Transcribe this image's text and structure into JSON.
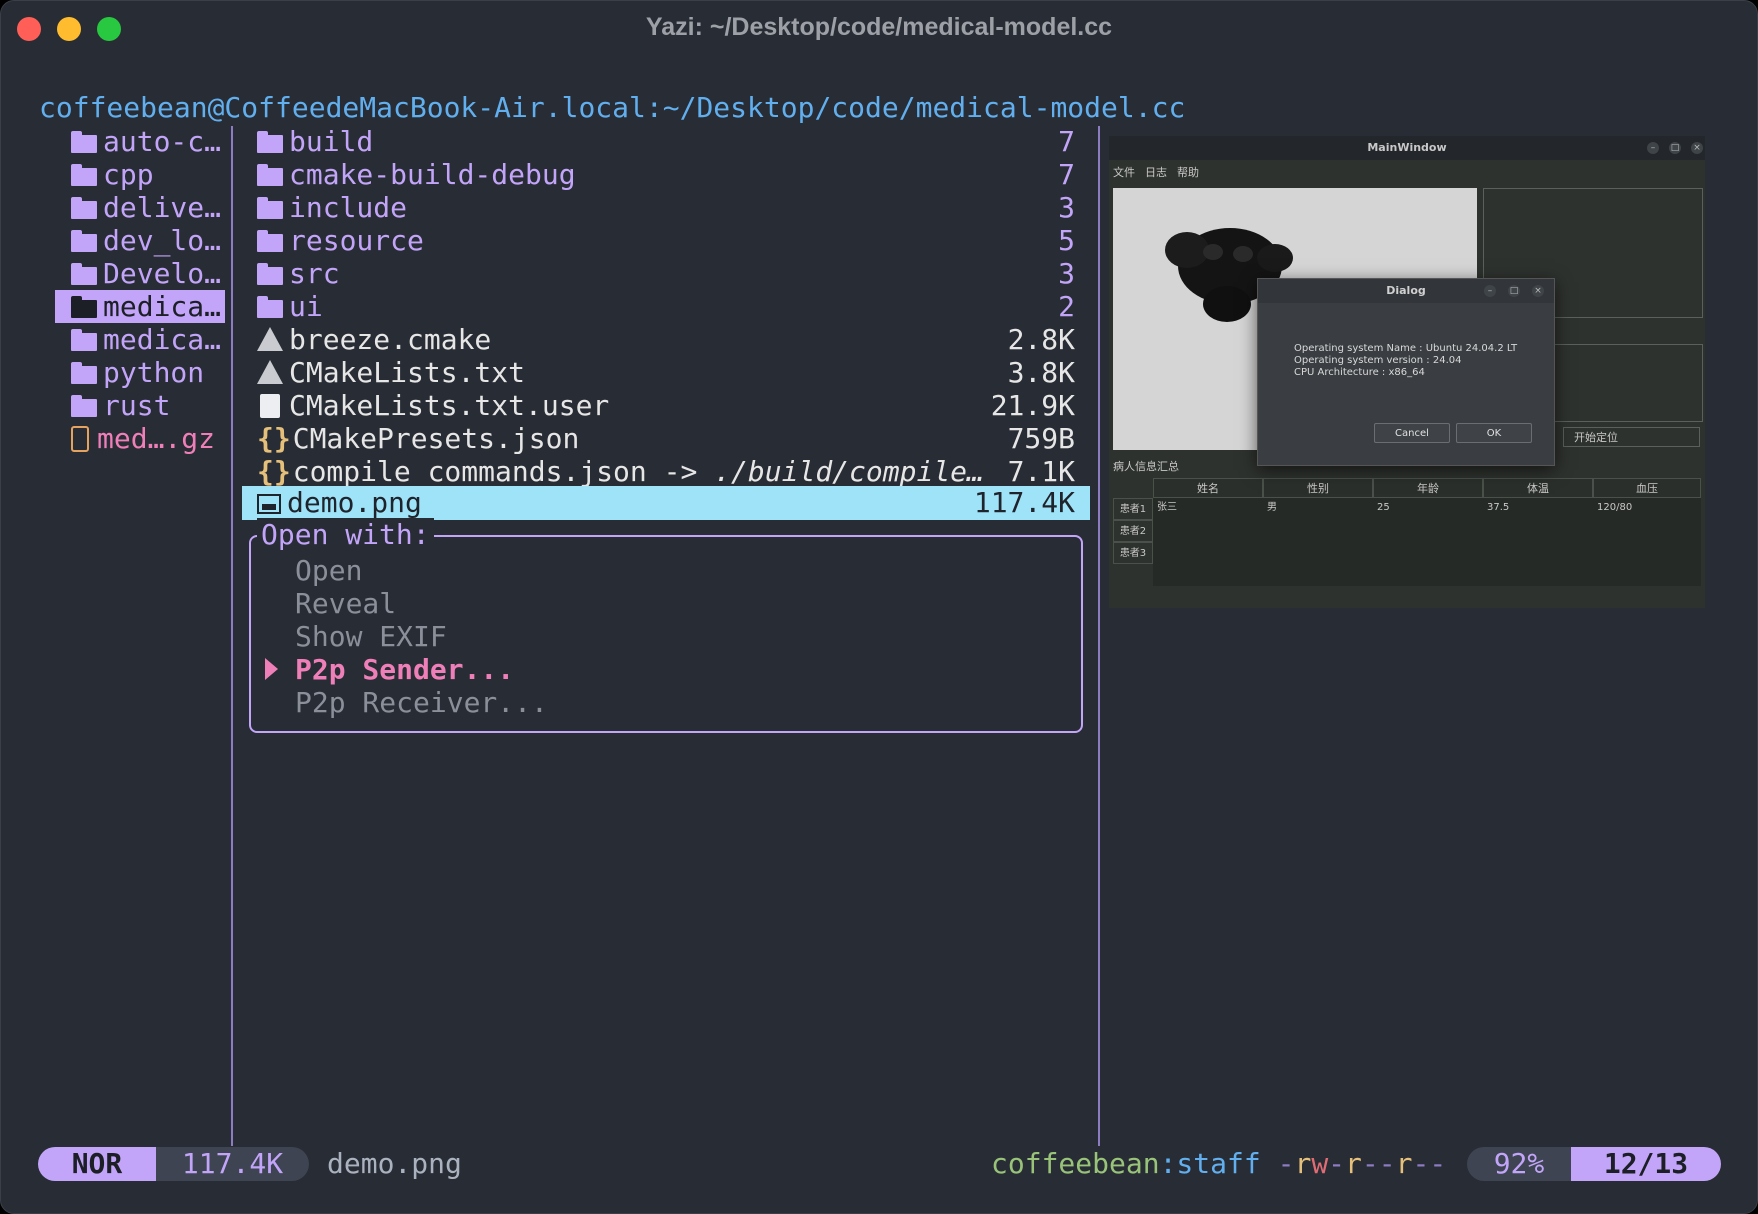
{
  "window": {
    "title": "Yazi: ~/Desktop/code/medical-model.cc"
  },
  "prompt": {
    "user_host": "coffeebean@CoffeedeMacBook-Air.local",
    "path": ":~/Desktop/code/medical-model.cc"
  },
  "parent": {
    "items": [
      {
        "name": "auto-c…",
        "type": "folder"
      },
      {
        "name": "cpp",
        "type": "folder"
      },
      {
        "name": "delive…",
        "type": "folder"
      },
      {
        "name": "dev_lo…",
        "type": "folder"
      },
      {
        "name": "Develo…",
        "type": "folder"
      },
      {
        "name": "medica…",
        "type": "folder",
        "selected": true
      },
      {
        "name": "medica…",
        "type": "folder"
      },
      {
        "name": "python",
        "type": "folder"
      },
      {
        "name": "rust",
        "type": "folder"
      },
      {
        "name": "med….gz",
        "type": "archive"
      }
    ]
  },
  "current": {
    "items": [
      {
        "name": "build",
        "size": "7",
        "type": "folder"
      },
      {
        "name": "cmake-build-debug",
        "size": "7",
        "type": "folder"
      },
      {
        "name": "include",
        "size": "3",
        "type": "folder"
      },
      {
        "name": "resource",
        "size": "5",
        "type": "folder"
      },
      {
        "name": "src",
        "size": "3",
        "type": "folder"
      },
      {
        "name": "ui",
        "size": "2",
        "type": "folder"
      },
      {
        "name": "breeze.cmake",
        "size": "2.8K",
        "type": "cmake"
      },
      {
        "name": "CMakeLists.txt",
        "size": "3.8K",
        "type": "cmake"
      },
      {
        "name": "CMakeLists.txt.user",
        "size": "21.9K",
        "type": "file"
      },
      {
        "name": "CMakePresets.json",
        "size": "759B",
        "type": "json"
      },
      {
        "name": "compile_commands.json",
        "link": " -> ",
        "link_target": "./build/compile…",
        "size": "7.1K",
        "type": "json"
      },
      {
        "name": "demo.png",
        "size": "117.4K",
        "type": "image",
        "hovered": true
      }
    ]
  },
  "open_with": {
    "title": "Open with:",
    "items": [
      "Open",
      "Reveal",
      "Show EXIF",
      "P2p Sender...",
      "P2p Receiver..."
    ],
    "active_index": 3
  },
  "preview": {
    "window_title": "MainWindow",
    "menu": [
      "文件",
      "日志",
      "帮助"
    ],
    "start_button": "开始定位",
    "table_label": "病人信息汇总",
    "columns": [
      "姓名",
      "性别",
      "年龄",
      "体温",
      "血压"
    ],
    "row_headers": [
      "患者1",
      "患者2",
      "患者3"
    ],
    "row1": [
      "张三",
      "男",
      "25",
      "37.5",
      "120/80"
    ],
    "dialog": {
      "title": "Dialog",
      "lines": [
        "Operating system Name : Ubuntu 24.04.2 LT",
        "Operating system version : 24.04",
        "CPU Architecture : x86_64"
      ],
      "cancel": "Cancel",
      "ok": "OK"
    }
  },
  "status": {
    "mode": "NOR",
    "size": "117.4K",
    "filename": "demo.png",
    "owner": "coffeebean",
    "group": ":staff",
    "perm_dash1": " -",
    "perm_r1": "r",
    "perm_w1": "w",
    "perm_dash2": "-",
    "perm_r2": "r",
    "perm_dash3": "--",
    "perm_r3": "r",
    "perm_dash4": "--",
    "percent": "92%",
    "position": "12/13"
  },
  "colors": {
    "accent": "#c2a5f9",
    "hover": "#9fe3f8",
    "pink": "#ef7fb8",
    "path": "#61afef",
    "owner": "#98c379",
    "perm_r": "#e5c07b",
    "perm_w": "#e06c75"
  }
}
